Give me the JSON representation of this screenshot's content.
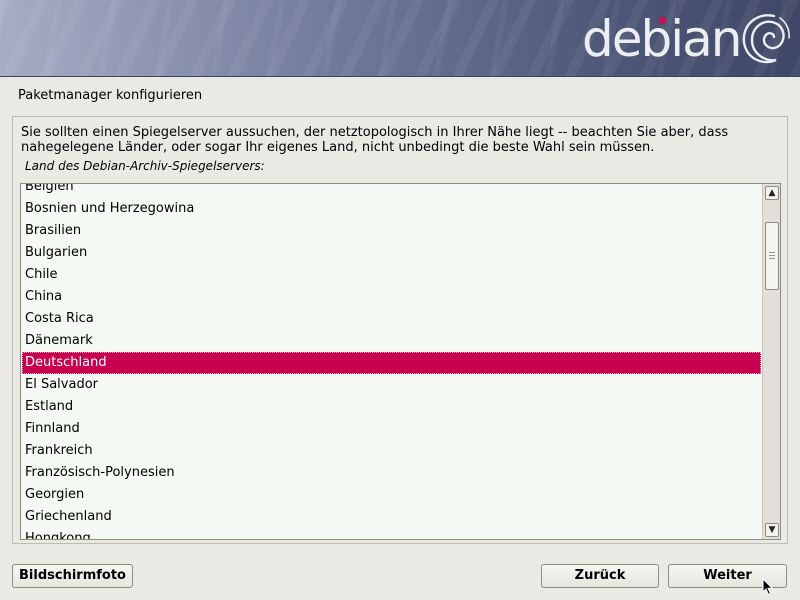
{
  "header": {
    "logo_text": "debian",
    "logo_accent_color": "#d70751"
  },
  "page": {
    "title": "Paketmanager konfigurieren"
  },
  "question": {
    "text": "Sie sollten einen Spiegelserver aussuchen, der netztopologisch in Ihrer Nähe liegt -- beachten Sie aber, dass nahegelegene Länder, oder sogar Ihr eigenes Land, nicht unbedingt die beste Wahl sein müssen.",
    "list_label": "Land des Debian-Archiv-Spiegelservers:"
  },
  "countries": {
    "items": [
      "Belgien",
      "Bosnien und Herzegowina",
      "Brasilien",
      "Bulgarien",
      "Chile",
      "China",
      "Costa Rica",
      "Dänemark",
      "Deutschland",
      "El Salvador",
      "Estland",
      "Finnland",
      "Frankreich",
      "Französisch-Polynesien",
      "Georgien",
      "Griechenland",
      "Hongkong"
    ],
    "selected": "Deutschland",
    "selection_color": "#c7004f"
  },
  "scrollbar": {
    "up_icon": "triangle-up",
    "down_icon": "triangle-down"
  },
  "buttons": {
    "screenshot": "Bildschirmfoto",
    "back": "Zurück",
    "next": "Weiter"
  }
}
